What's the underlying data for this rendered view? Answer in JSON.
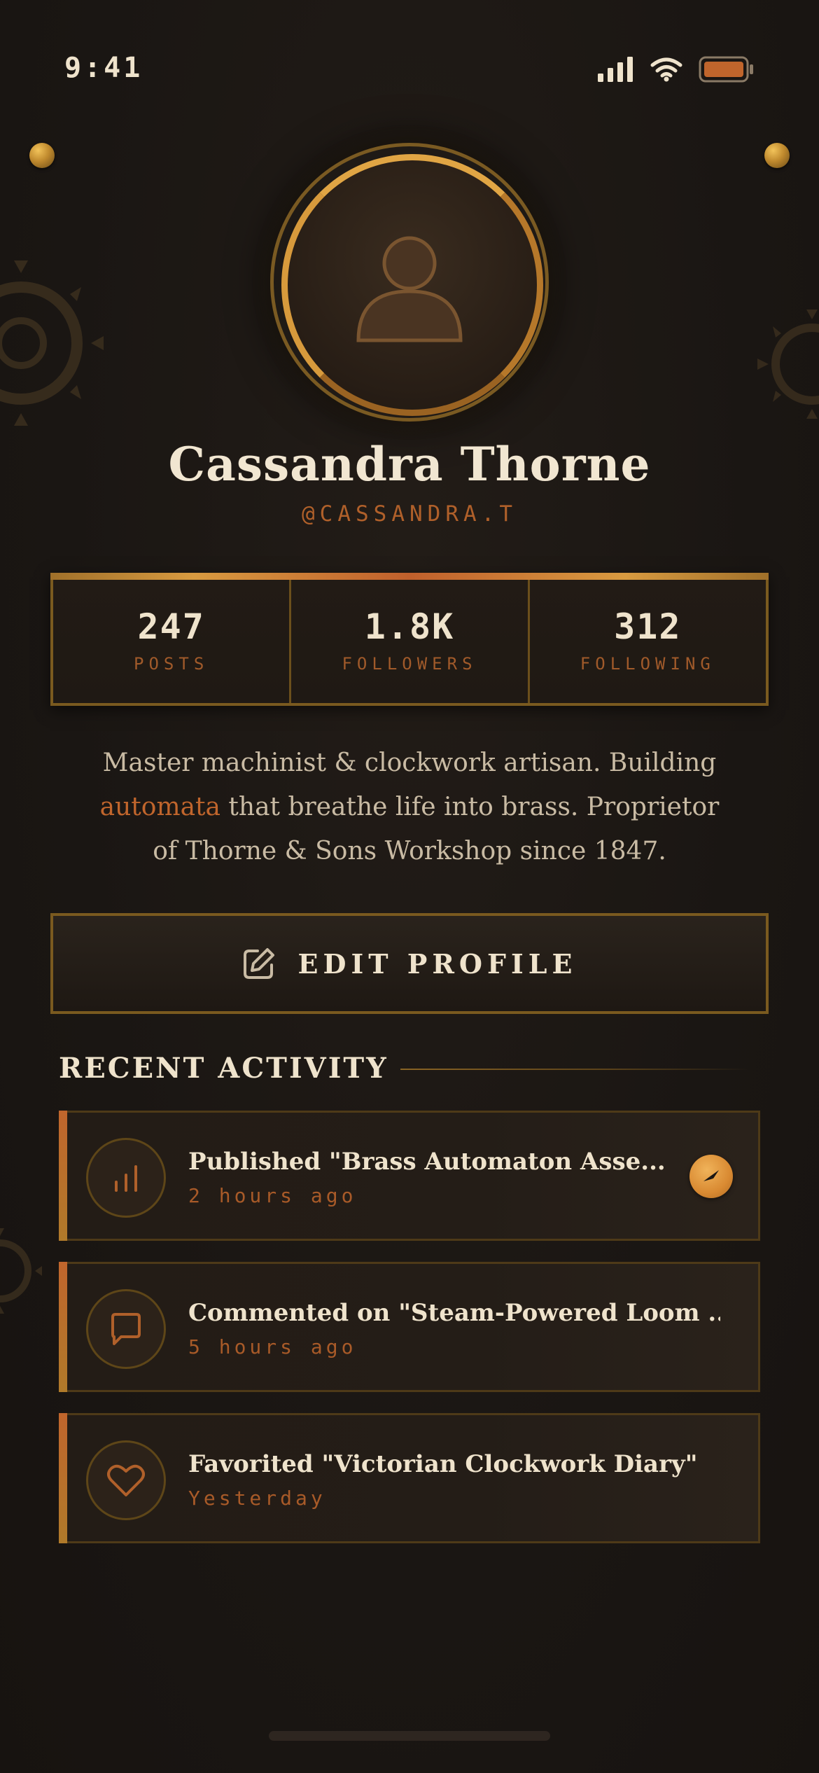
{
  "status_bar": {
    "time": "9:41",
    "icons": [
      "signal-icon",
      "wifi-icon",
      "battery-icon"
    ],
    "battery_color": "#c0652c"
  },
  "profile": {
    "avatar_icon": "user-icon",
    "name": "Cassandra Thorne",
    "handle": "@CASSANDRA.T"
  },
  "stats": [
    {
      "value": "247",
      "label": "POSTS"
    },
    {
      "value": "1.8K",
      "label": "FOLLOWERS"
    },
    {
      "value": "312",
      "label": "FOLLOWING"
    }
  ],
  "bio": {
    "before": "Master machinist & clockwork artisan. Building ",
    "highlight": "automata",
    "after": " that breathe life into brass. Proprietor of Thorne & Sons Workshop since 1847."
  },
  "edit_button": {
    "icon": "edit-icon",
    "label": "EDIT PROFILE"
  },
  "recent_activity": {
    "title": "RECENT ACTIVITY",
    "items": [
      {
        "icon": "chart-icon",
        "title": "Published \"Brass Automaton Asse...",
        "time": "2 hours ago",
        "badge_icon": "compass-icon"
      },
      {
        "icon": "comment-icon",
        "title": "Commented on \"Steam-Powered Loom ...",
        "time": "5 hours ago"
      },
      {
        "icon": "heart-icon",
        "title": "Favorited \"Victorian Clockwork Diary\"",
        "time": "Yesterday"
      }
    ]
  },
  "colors": {
    "background": "#1a1613",
    "brass": "#d6993c",
    "copper": "#c0652c",
    "text": "#efe3cc"
  }
}
